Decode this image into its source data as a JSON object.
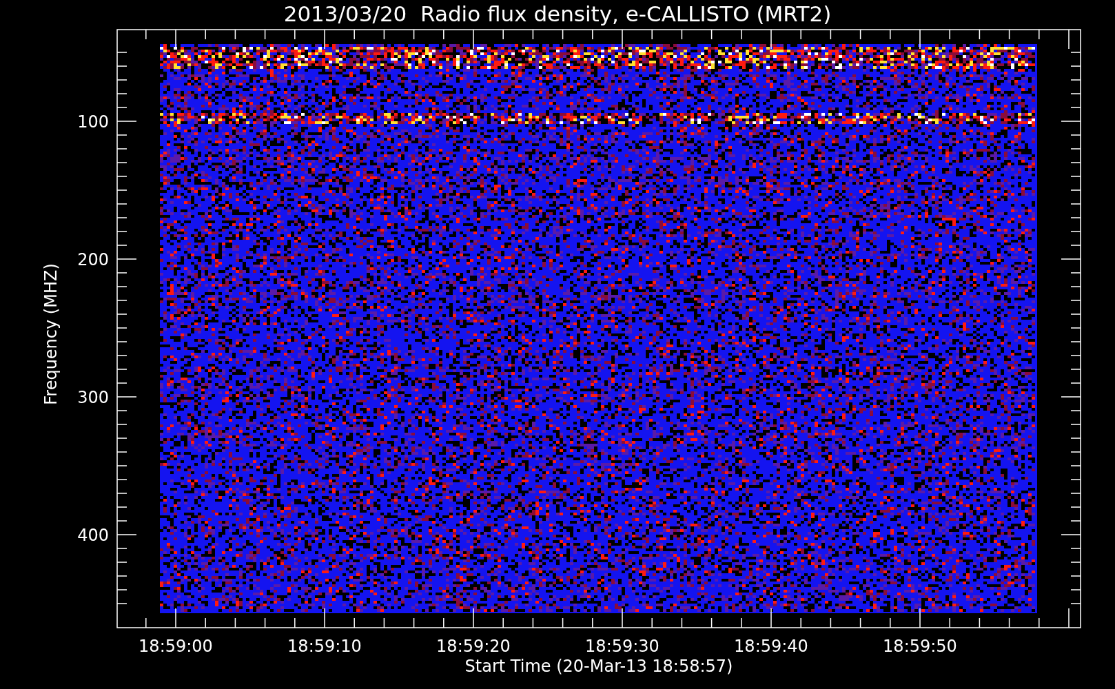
{
  "title": "2013/03/20  Radio flux density, e-CALLISTO (MRT2)",
  "y_axis": {
    "label": "Frequency (MHZ)",
    "ticks": [
      "100",
      "200",
      "300",
      "400"
    ]
  },
  "x_axis": {
    "label": "Start Time (20-Mar-13 18:58:57)",
    "ticks": [
      "18:59:00",
      "18:59:10",
      "18:59:20",
      "18:59:30",
      "18:59:40",
      "18:59:50"
    ]
  }
}
